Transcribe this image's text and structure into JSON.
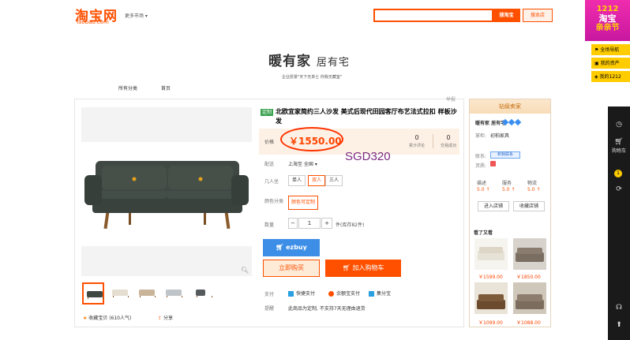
{
  "header": {
    "logo_cn": "淘宝网",
    "logo_en": "Taobao.com",
    "more_market": "更多市场 ▾",
    "search_placeholder": "",
    "search_button": "搜淘宝",
    "search_shop_button": "搜本店"
  },
  "right_sidebar": {
    "banner_line1": "1212",
    "banner_line2": "淘宝",
    "banner_line3": "亲亲节",
    "links": [
      "全场导航",
      "我的资产",
      "我的1212"
    ],
    "cart_label": "购物车",
    "cart_count": "1"
  },
  "shop": {
    "name": "暖有家",
    "name_sub": "居有宅",
    "tagline": "企业愿景\"天下无单士 你我无藏室\""
  },
  "nav": {
    "items": [
      "所有分类",
      "首页"
    ]
  },
  "report": "举报",
  "product": {
    "tag": "定制",
    "title": "北欧宜家简约三人沙发 美式后现代田园客厅布艺法式拉扣 样板沙发",
    "price_label": "价格",
    "price": "￥1550.00",
    "reviews_count": "0",
    "reviews_label": "累计评论",
    "sales_count": "0",
    "sales_label": "交易成功",
    "sgd_annotation": "SGD320",
    "shipping_label": "配送",
    "shipping_value": "上海至  全国 ▾",
    "seats_label": "几人坐",
    "seat_options": [
      "单人",
      "双人",
      "三人"
    ],
    "color_label": "颜色分类",
    "color_option": "颜色可定制",
    "qty_label": "数量",
    "qty_minus": "−",
    "qty_value": "1",
    "qty_plus": "+",
    "qty_stock": "件(库存82件)",
    "ezbuy_button": "ezbuy",
    "buy_now_button": "立即购买",
    "add_cart_button": "加入购物车",
    "pay_label": "支付",
    "pay_methods": [
      "快捷支付",
      "余额宝支付",
      "集分宝"
    ],
    "tip_label": "提醒",
    "tip_text": "此商品为定制, 不支持7天无理由退货",
    "favorite": "收藏宝贝 (610人气)",
    "share": "分享"
  },
  "seller": {
    "header": "钻级卖家",
    "shop_name": "暖有家 居有宅",
    "seller_label": "掌柜:",
    "seller_value": "初柏家具",
    "contact_label": "联系:",
    "contact_button": "和我联系",
    "qual_label": "资质:",
    "score_labels": [
      "描述",
      "服务",
      "物流"
    ],
    "score_values": [
      "5.0 ↑",
      "5.0 ↑",
      "5.0 ↑"
    ],
    "enter_shop": "进入店铺",
    "fav_shop": "收藏店铺",
    "seen_title": "看了又看",
    "seen_prices": [
      "￥1599.00",
      "￥1850.00",
      "￥1099.00",
      "￥1088.00"
    ]
  },
  "colors": {
    "brand": "#ff5000",
    "sofa": "#3f4843",
    "sgd": "#7a2a80"
  }
}
